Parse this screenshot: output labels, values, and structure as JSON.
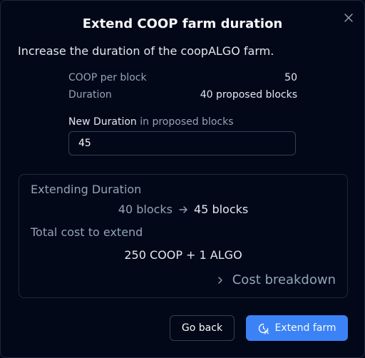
{
  "dialog": {
    "title": "Extend COOP farm duration",
    "description": "Increase the duration of the coopALGO farm."
  },
  "summary": {
    "coop_per_block_label": "COOP per block",
    "coop_per_block_value": "50",
    "duration_label": "Duration",
    "duration_value": "40 proposed blocks"
  },
  "new_duration": {
    "label": "New Duration",
    "label_hint": "in proposed blocks",
    "value": "45"
  },
  "extension": {
    "heading": "Extending Duration",
    "from": "40 blocks",
    "to": "45 blocks",
    "cost_heading": "Total cost to extend",
    "cost_value": "250 COOP + 1 ALGO",
    "breakdown_label": "Cost breakdown"
  },
  "buttons": {
    "back": "Go back",
    "extend": "Extend farm"
  },
  "icons": {
    "close": "close-icon",
    "arrow": "arrow-right-icon",
    "chevron": "chevron-right-icon",
    "extend": "clock-rotate-icon"
  },
  "colors": {
    "background": "#020817",
    "accent": "#3b82f6",
    "muted_text": "#94a3b8",
    "border": "#1e293b"
  }
}
